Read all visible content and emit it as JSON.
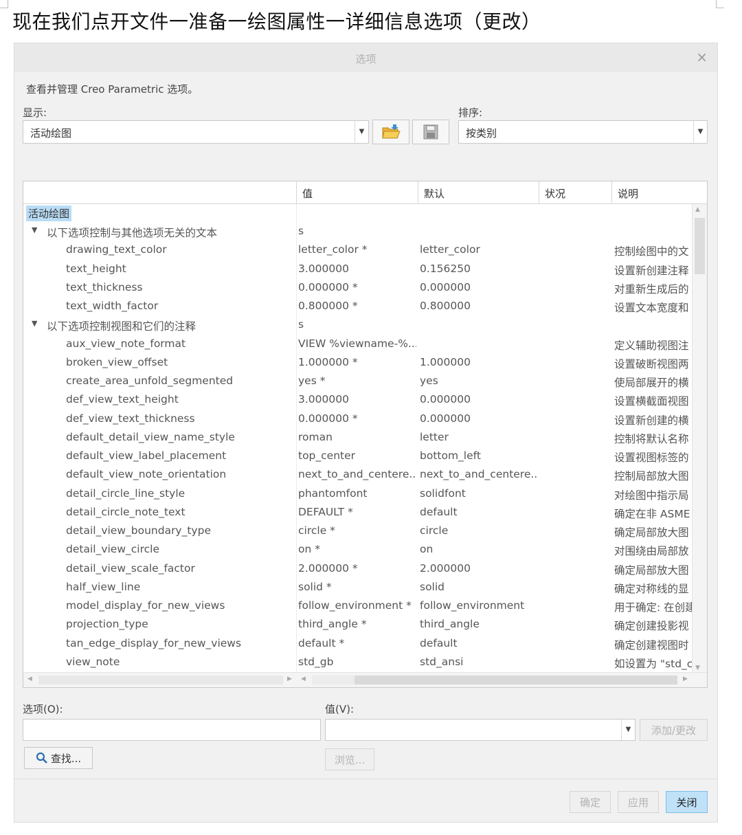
{
  "caption": "现在我们点开文件一准备一绘图属性一详细信息选项（更改）",
  "dialog": {
    "title": "选项",
    "close_glyph": "×",
    "description": "查看并管理 Creo Parametric 选项。",
    "show_label": "显示:",
    "show_value": "活动绘图",
    "sort_label": "排序:",
    "sort_value": "按类别",
    "icons": [
      "open-folder-icon",
      "save-disk-icon"
    ]
  },
  "table": {
    "headers": [
      "值",
      "默认",
      "状况",
      "说明"
    ],
    "root_label": "活动绘图",
    "rows": [
      {
        "type": "group",
        "name": "以下选项控制与其他选项无关的文本",
        "value": "s"
      },
      {
        "type": "item",
        "name": "drawing_text_color",
        "value": "letter_color *",
        "default": "letter_color",
        "desc": "控制绘图中的文"
      },
      {
        "type": "item",
        "name": "text_height",
        "value": "3.000000",
        "default": "0.156250",
        "desc": "设置新创建注释"
      },
      {
        "type": "item",
        "name": "text_thickness",
        "value": "0.000000 *",
        "default": "0.000000",
        "desc": "对重新生成后的"
      },
      {
        "type": "item",
        "name": "text_width_factor",
        "value": "0.800000 *",
        "default": "0.800000",
        "desc": "设置文本宽度和"
      },
      {
        "type": "group",
        "name": "以下选项控制视图和它们的注释",
        "value": "s"
      },
      {
        "type": "item",
        "name": "aux_view_note_format",
        "value": "VIEW %viewname-%...",
        "default": "",
        "desc": "定义辅助视图注"
      },
      {
        "type": "item",
        "name": "broken_view_offset",
        "value": "1.000000 *",
        "default": "1.000000",
        "desc": "设置破断视图两"
      },
      {
        "type": "item",
        "name": "create_area_unfold_segmented",
        "value": "yes *",
        "default": "yes",
        "desc": "使局部展开的横"
      },
      {
        "type": "item",
        "name": "def_view_text_height",
        "value": "3.000000",
        "default": "0.000000",
        "desc": "设置横截面视图"
      },
      {
        "type": "item",
        "name": "def_view_text_thickness",
        "value": "0.000000 *",
        "default": "0.000000",
        "desc": "设置新创建的横"
      },
      {
        "type": "item",
        "name": "default_detail_view_name_style",
        "value": "roman",
        "default": "letter",
        "desc": "控制将默认名称"
      },
      {
        "type": "item",
        "name": "default_view_label_placement",
        "value": "top_center",
        "default": "bottom_left",
        "desc": "设置视图标签的"
      },
      {
        "type": "item",
        "name": "default_view_note_orientation",
        "value": "next_to_and_centere...",
        "default": "next_to_and_centere...",
        "desc": "控制局部放大图"
      },
      {
        "type": "item",
        "name": "detail_circle_line_style",
        "value": "phantomfont",
        "default": "solidfont",
        "desc": "对绘图中指示局"
      },
      {
        "type": "item",
        "name": "detail_circle_note_text",
        "value": "DEFAULT *",
        "default": "default",
        "desc": "确定在非 ASME"
      },
      {
        "type": "item",
        "name": "detail_view_boundary_type",
        "value": "circle *",
        "default": "circle",
        "desc": "确定局部放大图"
      },
      {
        "type": "item",
        "name": "detail_view_circle",
        "value": "on *",
        "default": "on",
        "desc": "对围绕由局部放"
      },
      {
        "type": "item",
        "name": "detail_view_scale_factor",
        "value": "2.000000 *",
        "default": "2.000000",
        "desc": "确定局部放大图"
      },
      {
        "type": "item",
        "name": "half_view_line",
        "value": "solid *",
        "default": "solid",
        "desc": "确定对称线的显"
      },
      {
        "type": "item",
        "name": "model_display_for_new_views",
        "value": "follow_environment *",
        "default": "follow_environment",
        "desc": "用于确定: 在创建"
      },
      {
        "type": "item",
        "name": "projection_type",
        "value": "third_angle *",
        "default": "third_angle",
        "desc": "确定创建投影视"
      },
      {
        "type": "item",
        "name": "tan_edge_display_for_new_views",
        "value": "default *",
        "default": "default",
        "desc": "确定创建视图时"
      },
      {
        "type": "item",
        "name": "view_note",
        "value": "std_gb",
        "default": "std_ansi",
        "desc": "如设置为 \"std_c"
      }
    ]
  },
  "editor": {
    "option_label": "选项(O):",
    "value_label": "值(V):",
    "add_change_label": "添加/更改",
    "find_label": "查找...",
    "browse_label": "浏览..."
  },
  "footer": {
    "ok_label": "确定",
    "apply_label": "应用",
    "close_label": "关闭"
  },
  "colors": {
    "status_ok": "#2eb24a",
    "selection": "#b9dcf5",
    "primary_button": "#bfe2f8"
  }
}
